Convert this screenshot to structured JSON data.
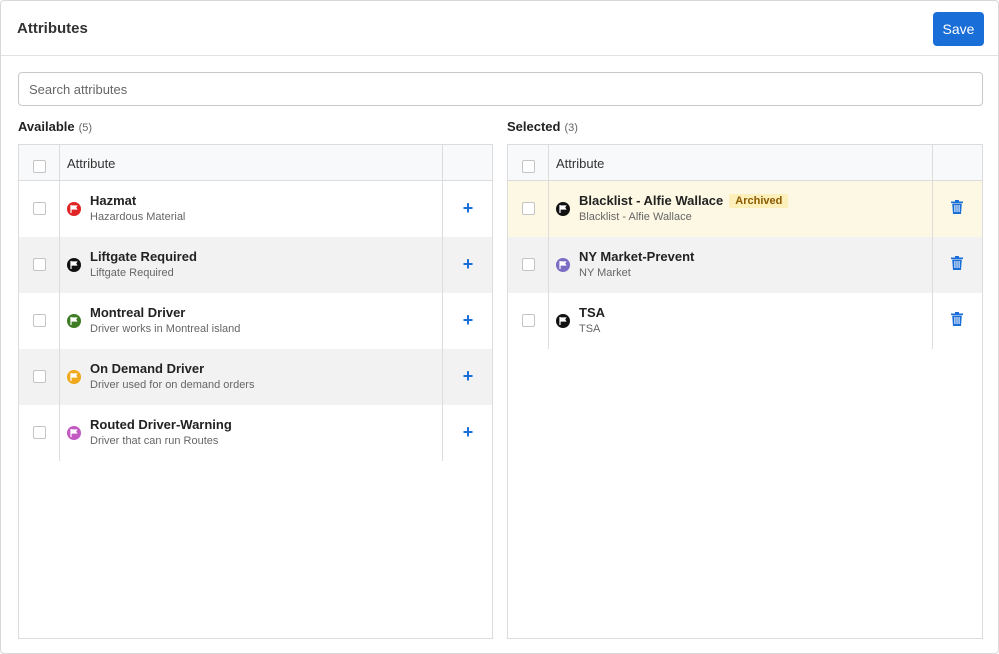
{
  "header": {
    "title": "Attributes",
    "save_label": "Save"
  },
  "search": {
    "placeholder": "Search attributes",
    "value": ""
  },
  "available": {
    "title": "Available",
    "count": "(5)",
    "column_header": "Attribute",
    "items": [
      {
        "name": "Hazmat",
        "description": "Hazardous Material",
        "color": "#e02424"
      },
      {
        "name": "Liftgate Required",
        "description": "Liftgate Required",
        "color": "#111111"
      },
      {
        "name": "Montreal Driver",
        "description": "Driver works in Montreal island",
        "color": "#3e7d23"
      },
      {
        "name": "On Demand Driver",
        "description": "Driver used for on demand orders",
        "color": "#f0a81c"
      },
      {
        "name": "Routed Driver-Warning",
        "description": "Driver that can run Routes",
        "color": "#c35ac3"
      }
    ]
  },
  "selected": {
    "title": "Selected",
    "count": "(3)",
    "column_header": "Attribute",
    "items": [
      {
        "name": "Blacklist - Alfie Wallace",
        "description": "Blacklist - Alfie Wallace",
        "color": "#111111",
        "badge": "Archived"
      },
      {
        "name": "NY Market-Prevent",
        "description": "NY Market",
        "color": "#7b6cc4"
      },
      {
        "name": "TSA",
        "description": "TSA",
        "color": "#111111"
      }
    ]
  },
  "colors": {
    "accent": "#1a6ed8",
    "archived_row": "#fdf8e4",
    "badge_bg": "#fcefb9",
    "badge_text": "#8a5a00"
  }
}
